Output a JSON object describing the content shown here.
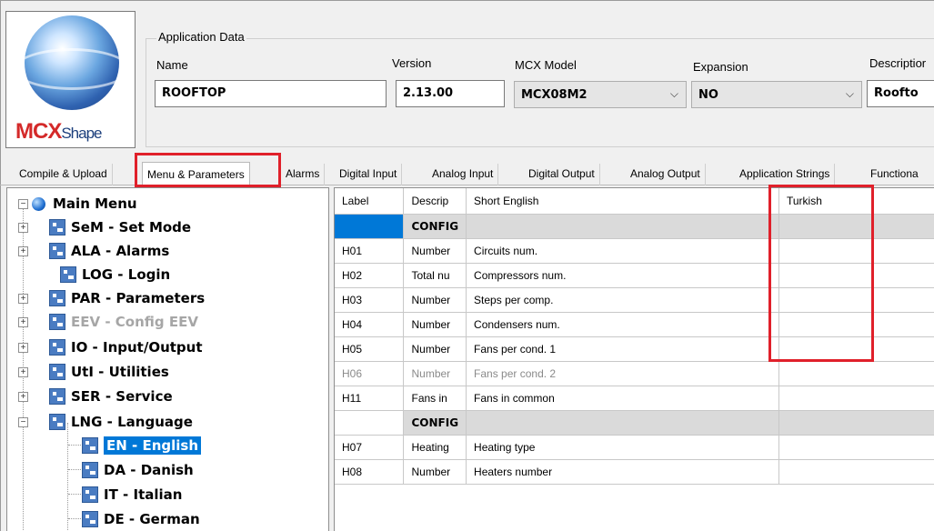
{
  "logo": {
    "brand_primary": "MCX",
    "brand_secondary": "Shape"
  },
  "app_data": {
    "group_title": "Application Data",
    "name_label": "Name",
    "name_value": "ROOFTOP",
    "version_label": "Version",
    "version_value": "2.13.00",
    "model_label": "MCX Model",
    "model_value": "MCX08M2",
    "expansion_label": "Expansion",
    "expansion_value": "NO",
    "description_label": "Descriptior",
    "description_value": "Roofto"
  },
  "tabs": [
    {
      "label": "Compile & Upload"
    },
    {
      "label": "Menu & Parameters"
    },
    {
      "label": "Alarms"
    },
    {
      "label": "Digital Input"
    },
    {
      "label": "Analog Input"
    },
    {
      "label": "Digital Output"
    },
    {
      "label": "Analog Output"
    },
    {
      "label": "Application Strings"
    },
    {
      "label": "Functiona"
    }
  ],
  "tree": {
    "root": "Main Menu",
    "items": [
      {
        "label": "SeM - Set Mode"
      },
      {
        "label": "ALA - Alarms"
      },
      {
        "label": "LOG - Login"
      },
      {
        "label": "PAR - Parameters"
      },
      {
        "label": "EEV - Config EEV"
      },
      {
        "label": "IO - Input/Output"
      },
      {
        "label": "UtI - Utilities"
      },
      {
        "label": "SER - Service"
      },
      {
        "label": "LNG - Language"
      },
      {
        "label": "EN - English"
      },
      {
        "label": "DA - Danish"
      },
      {
        "label": "IT - Italian"
      },
      {
        "label": "DE - German"
      }
    ]
  },
  "grid": {
    "headers": [
      "Label",
      "Descrip",
      "Short English",
      "Turkish"
    ],
    "rows": [
      {
        "label": "",
        "desc": "CONFIG",
        "short": "",
        "turkish": ""
      },
      {
        "label": "H01",
        "desc": "Number",
        "short": "Circuits num.",
        "turkish": ""
      },
      {
        "label": "H02",
        "desc": "Total nu",
        "short": "Compressors num.",
        "turkish": ""
      },
      {
        "label": "H03",
        "desc": "Number",
        "short": "Steps per comp.",
        "turkish": ""
      },
      {
        "label": "H04",
        "desc": "Number",
        "short": "Condensers num.",
        "turkish": ""
      },
      {
        "label": "H05",
        "desc": "Number",
        "short": "Fans per cond. 1",
        "turkish": ""
      },
      {
        "label": "H06",
        "desc": "Number",
        "short": "Fans per cond. 2",
        "turkish": ""
      },
      {
        "label": "H11",
        "desc": "Fans in",
        "short": "Fans in common",
        "turkish": ""
      },
      {
        "label": "",
        "desc": "CONFIG",
        "short": "",
        "turkish": ""
      },
      {
        "label": "H07",
        "desc": "Heating",
        "short": "Heating type",
        "turkish": ""
      },
      {
        "label": "H08",
        "desc": "Number",
        "short": "Heaters number",
        "turkish": ""
      }
    ]
  },
  "colors": {
    "highlight": "#e0202a",
    "selection": "#0078d7"
  }
}
